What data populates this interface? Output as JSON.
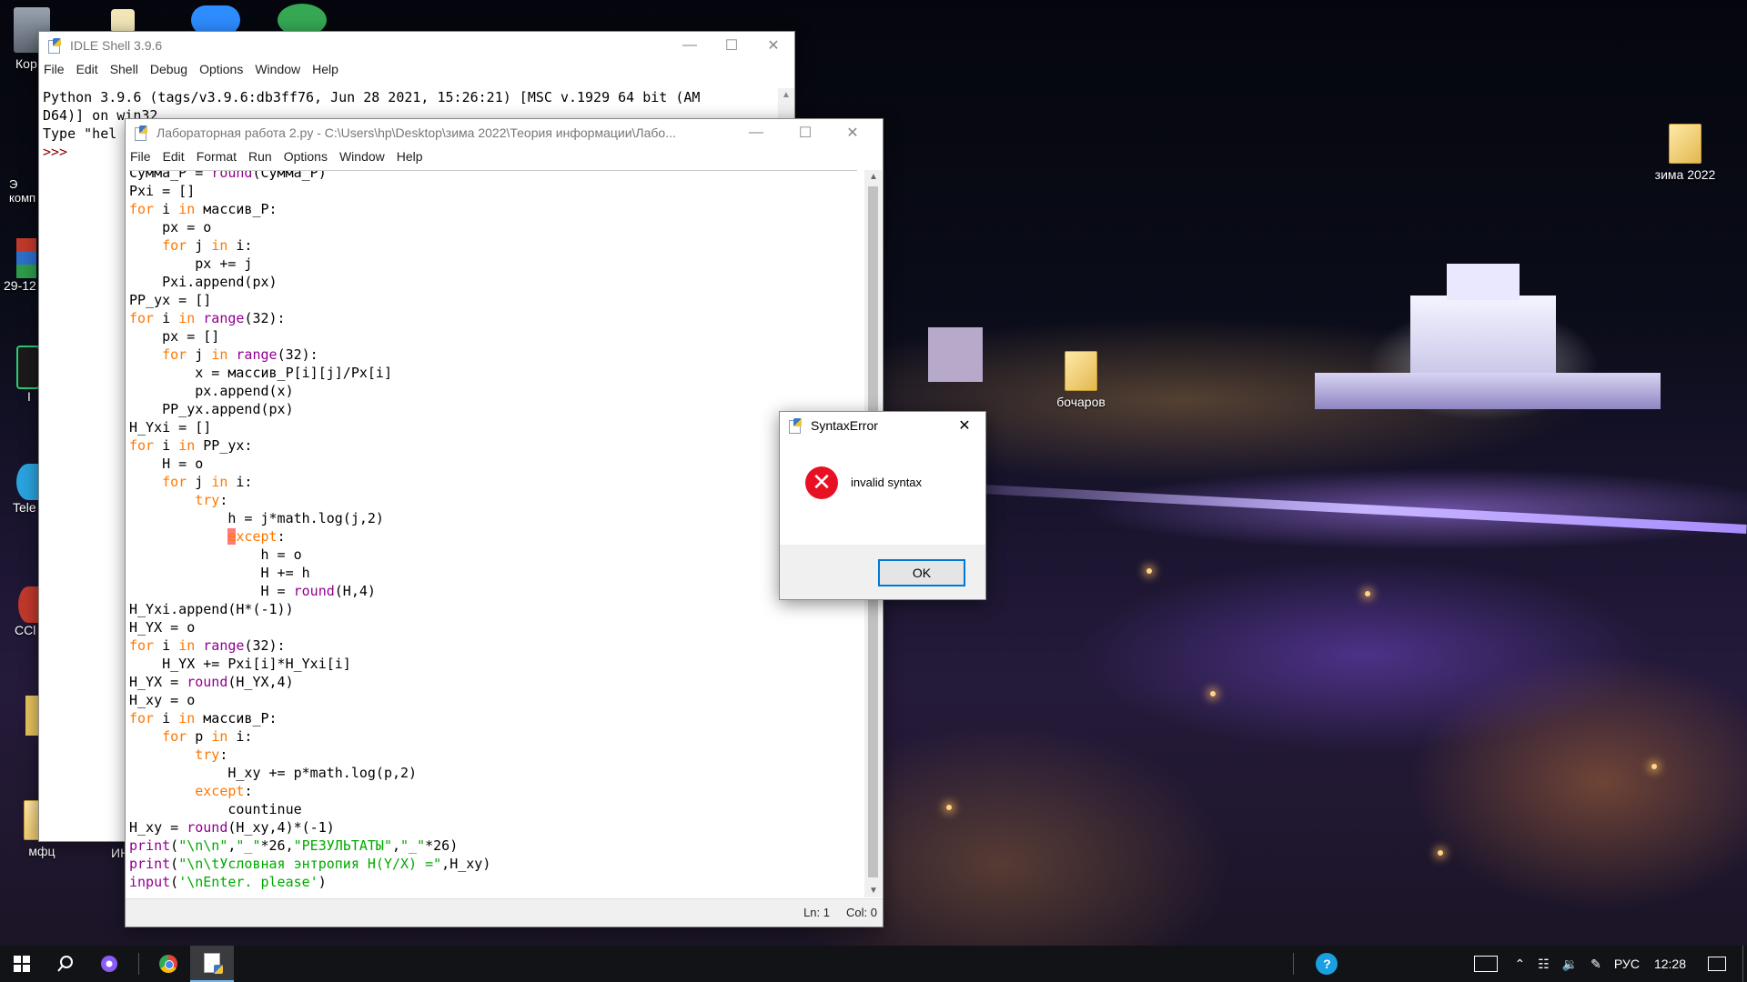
{
  "desktop": {
    "icons": [
      {
        "label": "Кор"
      },
      {
        "label": "Э\nкомп"
      },
      {
        "label": "29-12"
      },
      {
        "label": "I"
      },
      {
        "label": "Tele"
      },
      {
        "label": "CCl"
      },
      {
        "label": "мфц"
      },
      {
        "label": "ИН"
      },
      {
        "label": "бочаров"
      },
      {
        "label": "зима 2022"
      }
    ]
  },
  "shell": {
    "title": "IDLE Shell 3.9.6",
    "menu": [
      "File",
      "Edit",
      "Shell",
      "Debug",
      "Options",
      "Window",
      "Help"
    ],
    "lines": [
      "Python 3.9.6 (tags/v3.9.6:db3ff76, Jun 28 2021, 15:26:21) [MSC v.1929 64 bit (AM",
      "D64)] on win32",
      "Type \"hel",
      ">>> "
    ]
  },
  "editor": {
    "title": "Лабораторная работа 2.py - C:\\Users\\hp\\Desktop\\зима 2022\\Теория информации\\Лабо...",
    "menu": [
      "File",
      "Edit",
      "Format",
      "Run",
      "Options",
      "Window",
      "Help"
    ],
    "code": [
      [
        {
          "t": "Сумма_P = ",
          "c": ""
        },
        {
          "t": "round",
          "c": "bi"
        },
        {
          "t": "(Сумма_P)",
          "c": ""
        }
      ],
      [
        {
          "t": "Pxi = []",
          "c": ""
        }
      ],
      [
        {
          "t": "for",
          "c": "kw"
        },
        {
          "t": " i ",
          "c": ""
        },
        {
          "t": "in",
          "c": "kw"
        },
        {
          "t": " массив_P:",
          "c": ""
        }
      ],
      [
        {
          "t": "    px = o",
          "c": ""
        }
      ],
      [
        {
          "t": "    ",
          "c": ""
        },
        {
          "t": "for",
          "c": "kw"
        },
        {
          "t": " j ",
          "c": ""
        },
        {
          "t": "in",
          "c": "kw"
        },
        {
          "t": " i:",
          "c": ""
        }
      ],
      [
        {
          "t": "        px += j",
          "c": ""
        }
      ],
      [
        {
          "t": "    Pxi.append(px)",
          "c": ""
        }
      ],
      [
        {
          "t": "PP_yx = []",
          "c": ""
        }
      ],
      [
        {
          "t": "for",
          "c": "kw"
        },
        {
          "t": " i ",
          "c": ""
        },
        {
          "t": "in",
          "c": "kw"
        },
        {
          "t": " ",
          "c": ""
        },
        {
          "t": "range",
          "c": "bi"
        },
        {
          "t": "(32):",
          "c": ""
        }
      ],
      [
        {
          "t": "    px = []",
          "c": ""
        }
      ],
      [
        {
          "t": "    ",
          "c": ""
        },
        {
          "t": "for",
          "c": "kw"
        },
        {
          "t": " j ",
          "c": ""
        },
        {
          "t": "in",
          "c": "kw"
        },
        {
          "t": " ",
          "c": ""
        },
        {
          "t": "range",
          "c": "bi"
        },
        {
          "t": "(32):",
          "c": ""
        }
      ],
      [
        {
          "t": "        x = массив_P[i][j]/Px[i]",
          "c": ""
        }
      ],
      [
        {
          "t": "        px.append(x)",
          "c": ""
        }
      ],
      [
        {
          "t": "    PP_yx.append(px)",
          "c": ""
        }
      ],
      [
        {
          "t": "H_Yxi = []",
          "c": ""
        }
      ],
      [
        {
          "t": "for",
          "c": "kw"
        },
        {
          "t": " i ",
          "c": ""
        },
        {
          "t": "in",
          "c": "kw"
        },
        {
          "t": " PP_yx:",
          "c": ""
        }
      ],
      [
        {
          "t": "    H = o",
          "c": ""
        }
      ],
      [
        {
          "t": "    ",
          "c": ""
        },
        {
          "t": "for",
          "c": "kw"
        },
        {
          "t": " j ",
          "c": ""
        },
        {
          "t": "in",
          "c": "kw"
        },
        {
          "t": " i:",
          "c": ""
        }
      ],
      [
        {
          "t": "        ",
          "c": ""
        },
        {
          "t": "try",
          "c": "kw"
        },
        {
          "t": ":",
          "c": ""
        }
      ],
      [
        {
          "t": "            h = j*math.log(j,2)",
          "c": ""
        }
      ],
      [
        {
          "t": "            ",
          "c": ""
        },
        {
          "t": "e",
          "c": "hl kw"
        },
        {
          "t": "xcept",
          "c": "kw"
        },
        {
          "t": ":",
          "c": ""
        }
      ],
      [
        {
          "t": "                h = o",
          "c": ""
        }
      ],
      [
        {
          "t": "                H += h",
          "c": ""
        }
      ],
      [
        {
          "t": "                H = ",
          "c": ""
        },
        {
          "t": "round",
          "c": "bi"
        },
        {
          "t": "(H,4)",
          "c": ""
        }
      ],
      [
        {
          "t": "H_Yxi.append(H*(-1))",
          "c": ""
        }
      ],
      [
        {
          "t": "H_YX = o",
          "c": ""
        }
      ],
      [
        {
          "t": "for",
          "c": "kw"
        },
        {
          "t": " i ",
          "c": ""
        },
        {
          "t": "in",
          "c": "kw"
        },
        {
          "t": " ",
          "c": ""
        },
        {
          "t": "range",
          "c": "bi"
        },
        {
          "t": "(32):",
          "c": ""
        }
      ],
      [
        {
          "t": "    H_YX += Pxi[i]*H_Yxi[i]",
          "c": ""
        }
      ],
      [
        {
          "t": "H_YX = ",
          "c": ""
        },
        {
          "t": "round",
          "c": "bi"
        },
        {
          "t": "(H_YX,4)",
          "c": ""
        }
      ],
      [
        {
          "t": "H_xy = o",
          "c": ""
        }
      ],
      [
        {
          "t": "for",
          "c": "kw"
        },
        {
          "t": " i ",
          "c": ""
        },
        {
          "t": "in",
          "c": "kw"
        },
        {
          "t": " массив_P:",
          "c": ""
        }
      ],
      [
        {
          "t": "    ",
          "c": ""
        },
        {
          "t": "for",
          "c": "kw"
        },
        {
          "t": " p ",
          "c": ""
        },
        {
          "t": "in",
          "c": "kw"
        },
        {
          "t": " i:",
          "c": ""
        }
      ],
      [
        {
          "t": "        ",
          "c": ""
        },
        {
          "t": "try",
          "c": "kw"
        },
        {
          "t": ":",
          "c": ""
        }
      ],
      [
        {
          "t": "            H_xy += p*math.log(p,2)",
          "c": ""
        }
      ],
      [
        {
          "t": "        ",
          "c": ""
        },
        {
          "t": "except",
          "c": "kw"
        },
        {
          "t": ":",
          "c": ""
        }
      ],
      [
        {
          "t": "            countinue",
          "c": ""
        }
      ],
      [
        {
          "t": "H_xy = ",
          "c": ""
        },
        {
          "t": "round",
          "c": "bi"
        },
        {
          "t": "(H_xy,4)*(-1)",
          "c": ""
        }
      ],
      [
        {
          "t": "print",
          "c": "bi"
        },
        {
          "t": "(",
          "c": ""
        },
        {
          "t": "\"\\n\\n\"",
          "c": "st"
        },
        {
          "t": ",",
          "c": ""
        },
        {
          "t": "\"_\"",
          "c": "st"
        },
        {
          "t": "*26,",
          "c": ""
        },
        {
          "t": "\"РЕЗУЛЬТАТЫ\"",
          "c": "st"
        },
        {
          "t": ",",
          "c": ""
        },
        {
          "t": "\"_\"",
          "c": "st"
        },
        {
          "t": "*26)",
          "c": ""
        }
      ],
      [
        {
          "t": "print",
          "c": "bi"
        },
        {
          "t": "(",
          "c": ""
        },
        {
          "t": "\"\\n\\tУсловная энтропия H(Y/X) =\"",
          "c": "st"
        },
        {
          "t": ",H_xy)",
          "c": ""
        }
      ],
      [
        {
          "t": "input",
          "c": "bi"
        },
        {
          "t": "(",
          "c": ""
        },
        {
          "t": "'\\nEnter. please'",
          "c": "st"
        },
        {
          "t": ")",
          "c": ""
        }
      ]
    ],
    "status": {
      "line": "Ln: 1",
      "col": "Col: 0"
    }
  },
  "dialog": {
    "title": "SyntaxError",
    "message": "invalid syntax",
    "ok": "OK"
  },
  "taskbar": {
    "lang": "РУС",
    "time": "12:28"
  }
}
